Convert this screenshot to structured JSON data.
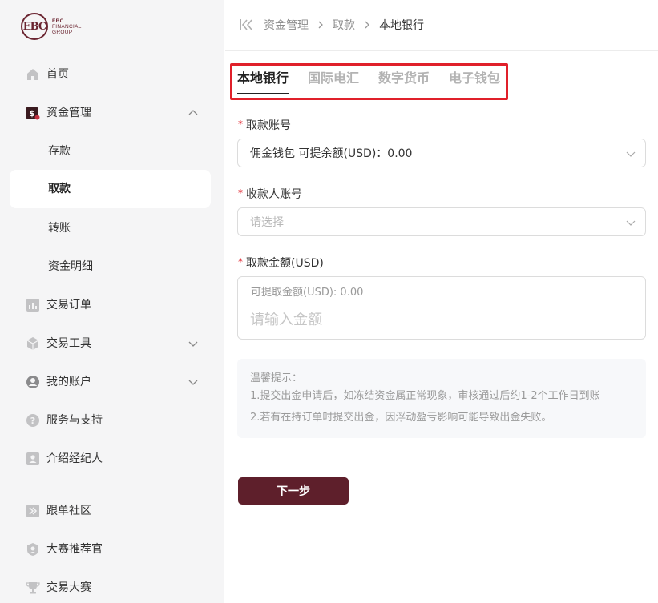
{
  "brand": {
    "logo_mark": "EBC",
    "line1": "EBC",
    "line2": "FINANCIAL",
    "line3": "GROUP",
    "color": "#6a2430"
  },
  "sidebar": {
    "items": [
      {
        "label": "首页",
        "icon": "home-icon"
      },
      {
        "label": "资金管理",
        "icon": "fund-management-icon",
        "expanded": true
      },
      {
        "label": "存款",
        "sub": true
      },
      {
        "label": "取款",
        "sub": true,
        "active": true
      },
      {
        "label": "转账",
        "sub": true
      },
      {
        "label": "资金明细",
        "sub": true
      },
      {
        "label": "交易订单",
        "icon": "bar-chart-icon"
      },
      {
        "label": "交易工具",
        "icon": "cube-icon",
        "collapsible": true
      },
      {
        "label": "我的账户",
        "icon": "user-icon",
        "collapsible": true
      },
      {
        "label": "服务与支持",
        "icon": "help-icon"
      },
      {
        "label": "介绍经纪人",
        "icon": "id-card-icon"
      },
      {
        "label": "跟单社区",
        "icon": "copy-trade-icon"
      },
      {
        "label": "大赛推荐官",
        "icon": "badge-icon"
      },
      {
        "label": "交易大赛",
        "icon": "trophy-icon"
      }
    ]
  },
  "breadcrumb": {
    "items": [
      "资金管理",
      "取款"
    ],
    "current": "本地银行"
  },
  "tabs": [
    {
      "label": "本地银行",
      "active": true
    },
    {
      "label": "国际电汇"
    },
    {
      "label": "数字货币"
    },
    {
      "label": "电子钱包"
    }
  ],
  "form": {
    "withdraw_account": {
      "label": "取款账号",
      "value": "佣金钱包  可提余额(USD)：0.00"
    },
    "payee_account": {
      "label": "收款人账号",
      "placeholder": "请选择"
    },
    "amount": {
      "label": "取款金额(USD)",
      "hint": "可提取金额(USD): 0.00",
      "placeholder": "请输入金额"
    }
  },
  "tips": {
    "title": "温馨提示：",
    "lines": [
      "1.提交出金申请后，如冻结资金属正常现象，审核通过后约1-2个工作日到账",
      "2.若有在持订单时提交出金，因浮动盈亏影响可能导致出金失败。"
    ]
  },
  "actions": {
    "next_label": "下一步"
  },
  "colors": {
    "accent": "#5e1f2b",
    "highlight_frame": "#e0202a",
    "required_mark": "#e0202a"
  }
}
